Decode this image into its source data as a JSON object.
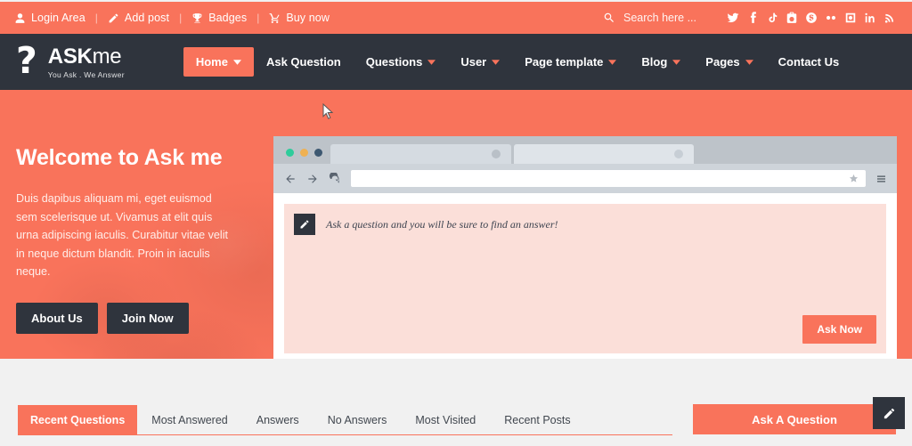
{
  "topbar": {
    "links": [
      {
        "label": "Login Area",
        "icon": "user-icon"
      },
      {
        "label": "Add post",
        "icon": "pencil-icon"
      },
      {
        "label": "Badges",
        "icon": "trophy-icon"
      },
      {
        "label": "Buy now",
        "icon": "cart-icon"
      }
    ],
    "separator": "|",
    "search": {
      "placeholder": "Search here ...",
      "value": "",
      "icon": "search-icon"
    },
    "social": [
      "twitter-icon",
      "facebook-icon",
      "tiktok-icon",
      "youtube-icon",
      "skype-icon",
      "flickr-icon",
      "instagram-icon",
      "linkedin-icon",
      "rss-icon"
    ]
  },
  "brand": {
    "mark": "?",
    "name_bold": "ASK",
    "name_thin": "me",
    "tagline": "You Ask . We Answer"
  },
  "nav": {
    "items": [
      {
        "label": "Home",
        "caret": true,
        "active": true
      },
      {
        "label": "Ask Question",
        "caret": false,
        "active": false
      },
      {
        "label": "Questions",
        "caret": true,
        "active": false
      },
      {
        "label": "User",
        "caret": true,
        "active": false
      },
      {
        "label": "Page template",
        "caret": true,
        "active": false
      },
      {
        "label": "Blog",
        "caret": true,
        "active": false
      },
      {
        "label": "Pages",
        "caret": true,
        "active": false
      },
      {
        "label": "Contact Us",
        "caret": false,
        "active": false
      }
    ]
  },
  "hero": {
    "title": "Welcome to Ask me",
    "copy": "Duis dapibus aliquam mi, eget euismod sem scelerisque ut. Vivamus at elit quis urna adipiscing iaculis. Curabitur vitae velit in neque dictum blandit. Proin in iaculis neque.",
    "buttons": [
      {
        "label": "About Us"
      },
      {
        "label": "Join Now"
      }
    ]
  },
  "browser": {
    "url_value": "",
    "tabs": [
      {
        "title": ""
      },
      {
        "title": ""
      }
    ],
    "question_placeholder": "Ask a question and you will be sure to find an answer!",
    "ask_now_label": "Ask Now"
  },
  "bottom": {
    "tabs": [
      {
        "label": "Recent Questions",
        "active": true
      },
      {
        "label": "Most Answered",
        "active": false
      },
      {
        "label": "Answers",
        "active": false
      },
      {
        "label": "No Answers",
        "active": false
      },
      {
        "label": "Most Visited",
        "active": false
      },
      {
        "label": "Recent Posts",
        "active": false
      }
    ],
    "ask_question_label": "Ask A Question"
  },
  "colors": {
    "accent": "#f9735b",
    "dark": "#2f343d",
    "panel_pink": "#fbdfd9",
    "page_gray": "#f1f1f1"
  }
}
